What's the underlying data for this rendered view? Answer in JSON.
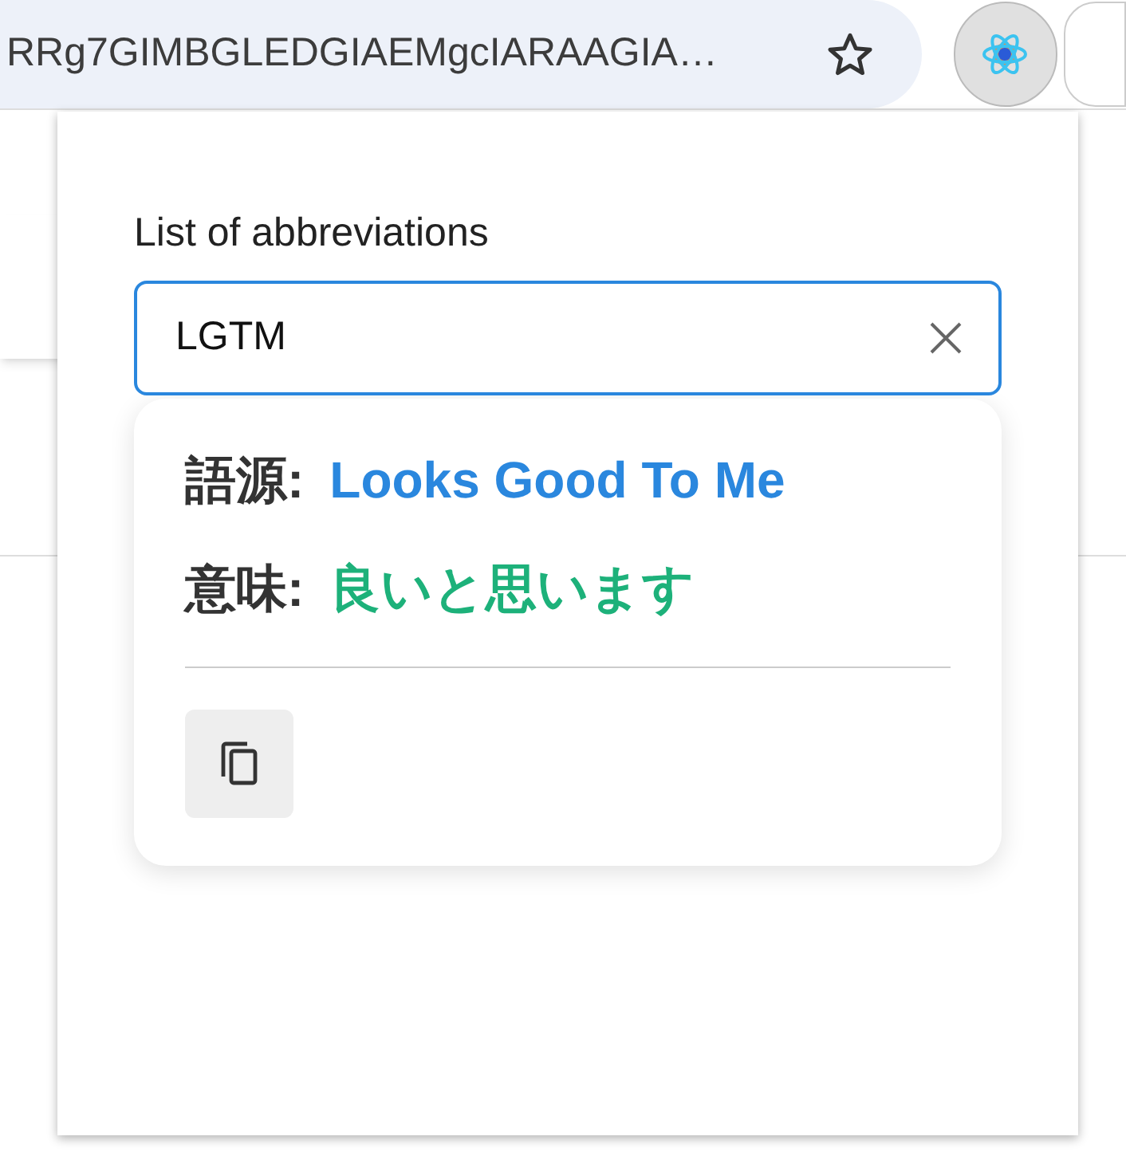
{
  "address_bar": {
    "url": "RRg7GIMBGLEDGIAEMgcIARAAGIA…"
  },
  "popup": {
    "label": "List of abbreviations",
    "search": {
      "value": "LGTM"
    },
    "result": {
      "rows": [
        {
          "label": "語源:",
          "value": "Looks Good To Me",
          "color": "#2a87de"
        },
        {
          "label": "意味:",
          "value": "良いと思います",
          "color": "#1db17a"
        }
      ]
    }
  }
}
